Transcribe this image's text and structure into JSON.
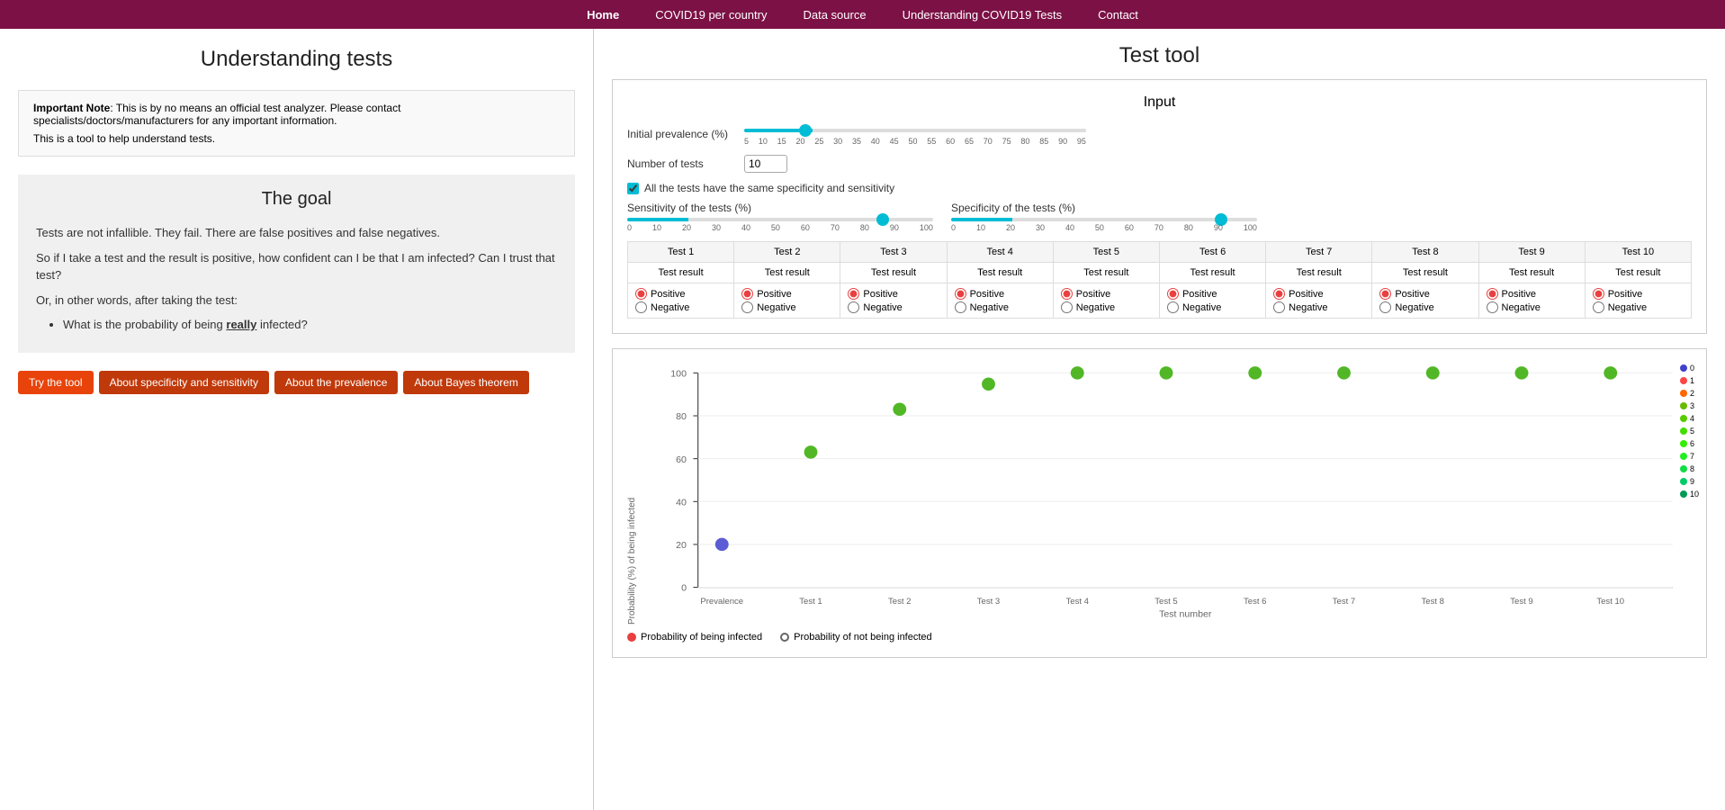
{
  "nav": {
    "items": [
      {
        "label": "Home",
        "active": true
      },
      {
        "label": "COVID19 per country",
        "active": false
      },
      {
        "label": "Data source",
        "active": false
      },
      {
        "label": "Understanding COVID19 Tests",
        "active": false
      },
      {
        "label": "Contact",
        "active": false
      }
    ]
  },
  "left": {
    "title": "Understanding tests",
    "note_important": "Important Note",
    "note_text": ": This is by no means an official test analyzer. Please contact specialists/doctors/manufacturers for any important information.",
    "note_sub": "This is a tool to help understand tests.",
    "goal_title": "The goal",
    "paragraphs": [
      "Tests are not infallible. They fail. There are false positives and false negatives.",
      "So if I take a test and the result is positive, how confident can I be that I am infected? Can I trust that test?",
      "Or, in other words, after taking the test:"
    ],
    "bullet": "What is the probability of being really infected?",
    "buttons": [
      {
        "label": "Try the tool",
        "style": "orange"
      },
      {
        "label": "About specificity and sensitivity",
        "style": "dark-orange"
      },
      {
        "label": "About the prevalence",
        "style": "dark-orange"
      },
      {
        "label": "About Bayes theorem",
        "style": "dark-orange"
      }
    ]
  },
  "right": {
    "title": "Test tool",
    "input_title": "Input",
    "prevalence_label": "Initial prevalence (%)",
    "prevalence_value": 20,
    "prevalence_min": 5,
    "prevalence_max": 95,
    "prevalence_ticks": [
      "5",
      "10",
      "15",
      "20",
      "25",
      "30",
      "35",
      "40",
      "45",
      "50",
      "55",
      "60",
      "65",
      "70",
      "75",
      "80",
      "85",
      "90",
      "95"
    ],
    "num_tests_label": "Number of tests",
    "num_tests_value": 10,
    "checkbox_label": "All the tests have the same specificity and sensitivity",
    "sensitivity_label": "Sensitivity of the tests (%)",
    "sensitivity_ticks": [
      "0",
      "10",
      "20",
      "30",
      "40",
      "50",
      "60",
      "70",
      "80",
      "90",
      "100"
    ],
    "sensitivity_value": 85,
    "specificity_label": "Specificity of the tests (%)",
    "specificity_ticks": [
      "0",
      "10",
      "20",
      "30",
      "40",
      "50",
      "60",
      "70",
      "80",
      "90",
      "100"
    ],
    "specificity_value": 90,
    "tests": [
      {
        "label": "Test 1"
      },
      {
        "label": "Test 2"
      },
      {
        "label": "Test 3"
      },
      {
        "label": "Test 4"
      },
      {
        "label": "Test 5"
      },
      {
        "label": "Test 6"
      },
      {
        "label": "Test 7"
      },
      {
        "label": "Test 8"
      },
      {
        "label": "Test 9"
      },
      {
        "label": "Test 10"
      }
    ],
    "test_result_label": "Test result",
    "positive_label": "Positive",
    "negative_label": "Negative",
    "chart": {
      "y_axis_label": "Probability (%) of being infected",
      "x_axis_label": "Test number",
      "x_labels": [
        "Prevalence",
        "Test 1",
        "Test 2",
        "Test 3",
        "Test 4",
        "Test 5",
        "Test 6",
        "Test 7",
        "Test 8",
        "Test 9",
        "Test 10"
      ],
      "y_ticks": [
        "0",
        "20",
        "40",
        "60",
        "80",
        "100"
      ],
      "dots": [
        {
          "x_index": 0,
          "y": 20,
          "color": "blue"
        },
        {
          "x_index": 1,
          "y": 63,
          "color": "green"
        },
        {
          "x_index": 2,
          "y": 83,
          "color": "green"
        },
        {
          "x_index": 3,
          "y": 95,
          "color": "green"
        },
        {
          "x_index": 4,
          "y": 100,
          "color": "green"
        },
        {
          "x_index": 5,
          "y": 100,
          "color": "green"
        },
        {
          "x_index": 6,
          "y": 100,
          "color": "green"
        },
        {
          "x_index": 7,
          "y": 100,
          "color": "green"
        },
        {
          "x_index": 8,
          "y": 100,
          "color": "green"
        },
        {
          "x_index": 9,
          "y": 100,
          "color": "green"
        },
        {
          "x_index": 10,
          "y": 100,
          "color": "green"
        }
      ],
      "legend_infected": "Probability of being infected",
      "legend_not_infected": "Probability of not being infected",
      "right_legend": [
        {
          "num": "0",
          "color": "#4040d0"
        },
        {
          "num": "1",
          "color": "#ff4444"
        },
        {
          "num": "2",
          "color": "#ff6600"
        },
        {
          "num": "3",
          "color": "#44aa00"
        },
        {
          "num": "4",
          "color": "#33bb00"
        },
        {
          "num": "5",
          "color": "#22cc00"
        },
        {
          "num": "6",
          "color": "#11dd00"
        },
        {
          "num": "7",
          "color": "#00ee00"
        },
        {
          "num": "8",
          "color": "#00dd22"
        },
        {
          "num": "9",
          "color": "#00cc44"
        },
        {
          "num": "10",
          "color": "#009955"
        }
      ]
    }
  }
}
